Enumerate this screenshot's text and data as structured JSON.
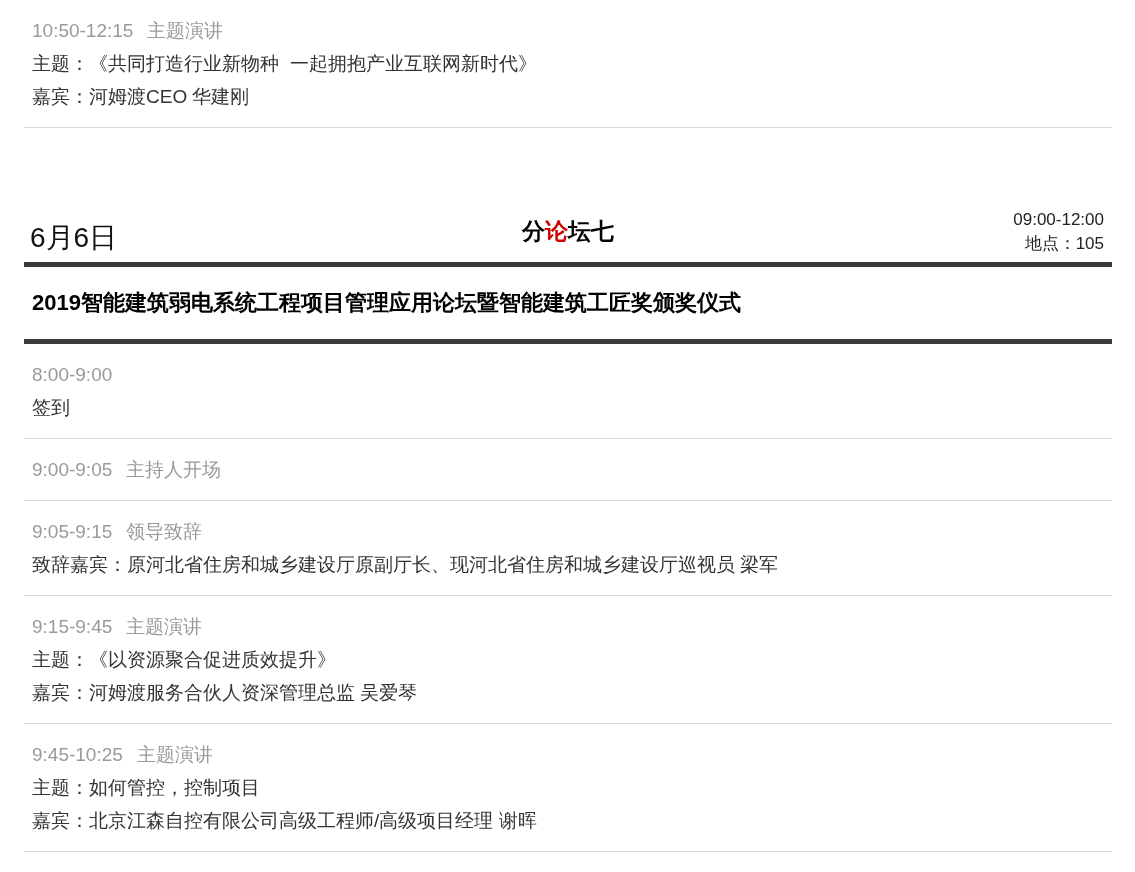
{
  "previous_items": [
    {
      "time": "10:50-12:15",
      "topic": "主题演讲",
      "lines": [
        "主题：《共同打造行业新物种  一起拥抱产业互联网新时代》",
        "嘉宾：河姆渡CEO 华建刚"
      ]
    }
  ],
  "forum": {
    "date": "6月6日",
    "title_before": "分",
    "title_highlight": "论",
    "title_after": "坛七",
    "time": "09:00-12:00",
    "location": "地点：105",
    "name": "2019智能建筑弱电系统工程项目管理应用论坛暨智能建筑工匠奖颁奖仪式"
  },
  "items": [
    {
      "time": "8:00-9:00",
      "lines": [
        "签到"
      ]
    },
    {
      "time": "9:00-9:05",
      "topic": "主持人开场"
    },
    {
      "time": "9:05-9:15",
      "topic": "领导致辞",
      "lines": [
        "致辞嘉宾：原河北省住房和城乡建设厅原副厅长、现河北省住房和城乡建设厅巡视员 梁军"
      ]
    },
    {
      "time": "9:15-9:45",
      "topic": "主题演讲",
      "lines": [
        "主题：《以资源聚合促进质效提升》",
        "嘉宾：河姆渡服务合伙人资深管理总监 吴爱琴"
      ]
    },
    {
      "time": "9:45-10:25",
      "topic": "主题演讲",
      "lines": [
        "主题：如何管控，控制项目",
        "嘉宾：北京江森自控有限公司高级工程师/高级项目经理 谢晖"
      ]
    }
  ]
}
